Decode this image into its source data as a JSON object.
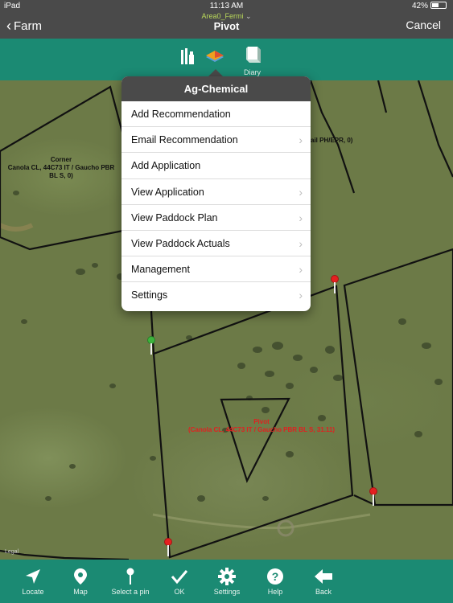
{
  "status": {
    "device": "iPad",
    "time": "11:13 AM",
    "battery": "42%"
  },
  "nav": {
    "back_label": "Farm",
    "subtitle": "Area0_Fermi",
    "title": "Pivot",
    "cancel_label": "Cancel"
  },
  "toolbar": {
    "diary_label": "Diary"
  },
  "map": {
    "corner_label": "Corner\nCanola CL, 44C73 IT / Gaucho PBR\nBL S, 0)",
    "right_label": "ail  PH/EPR, 0)",
    "pivot_label": "Pivot\n(Canola CL, 44C73 IT / Gaucho PBR BL S, 31.11)",
    "legal": "Legal"
  },
  "popover": {
    "title": "Ag-Chemical",
    "items": [
      {
        "label": "Add Recommendation",
        "chevron": false
      },
      {
        "label": "Email Recommendation",
        "chevron": true
      },
      {
        "label": "Add Application",
        "chevron": false
      },
      {
        "label": "View Application",
        "chevron": true
      },
      {
        "label": "View Paddock Plan",
        "chevron": true
      },
      {
        "label": "View Paddock Actuals",
        "chevron": true
      },
      {
        "label": "Management",
        "chevron": true
      },
      {
        "label": "Settings",
        "chevron": true
      }
    ]
  },
  "bottom": {
    "items": [
      {
        "label": "Locate",
        "icon": "locate-icon"
      },
      {
        "label": "Map",
        "icon": "map-pin-icon"
      },
      {
        "label": "Select a pin",
        "icon": "select-pin-icon"
      },
      {
        "label": "OK",
        "icon": "checkmark-icon"
      },
      {
        "label": "Settings",
        "icon": "gear-icon"
      },
      {
        "label": "Help",
        "icon": "help-icon"
      },
      {
        "label": "Back",
        "icon": "back-arrow-icon"
      }
    ]
  },
  "colors": {
    "accent": "#1b8a73",
    "bar": "#4a4a4a",
    "pivot_label": "#e02020",
    "pin_red": "#e42020",
    "pin_green": "#3cb43c"
  }
}
